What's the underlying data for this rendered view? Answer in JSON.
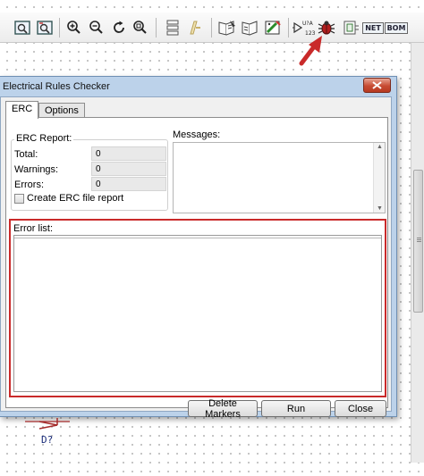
{
  "toolbar": {
    "icons": [
      "zoom-page-icon",
      "zoom-redraw-icon",
      "zoom-in-icon",
      "zoom-out-icon",
      "zoom-refresh-icon",
      "navigate-hierarchy-icon",
      "hierarchy-navigator-icon",
      "library-editor-icon",
      "library-browser-icon",
      "footprint-editor-icon",
      "annotate-icon",
      "erc-bug-icon",
      "cvpcb-icon",
      "netlist-icon",
      "bom-icon"
    ],
    "annotate_text": "U?A",
    "annotate_sub": "123",
    "netlist_text": "NET",
    "bom_text": "BOM"
  },
  "dialog": {
    "title": "Electrical Rules Checker",
    "tabs": [
      {
        "label": "ERC",
        "active": true
      },
      {
        "label": "Options",
        "active": false
      }
    ],
    "erc_report": {
      "title": "ERC Report:",
      "rows": [
        {
          "label": "Total:",
          "value": "0"
        },
        {
          "label": "Warnings:",
          "value": "0"
        },
        {
          "label": "Errors:",
          "value": "0"
        }
      ],
      "checkbox_label": "Create ERC file report",
      "checkbox_checked": false
    },
    "messages_label": "Messages:",
    "error_list_label": "Error list:",
    "buttons": {
      "delete_markers": "Delete Markers",
      "run": "Run",
      "close": "Close"
    }
  },
  "schematic": {
    "component_ref": "D?"
  },
  "colors": {
    "annotation_red": "#c92a2a",
    "dialog_frame": "#bcd2ea",
    "component_red": "#a52a2a",
    "ref_blue": "#1a2c7a"
  }
}
